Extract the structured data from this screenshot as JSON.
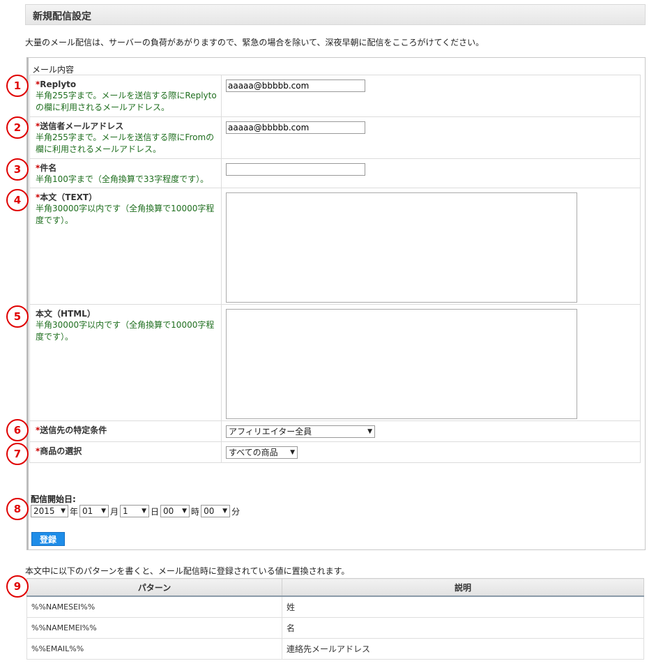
{
  "page_title": "新規配信設定",
  "notice": "大量のメール配信は、サーバーの負荷があがりますので、緊急の場合を除いて、深夜早朝に配信をこころがけてください。",
  "mail_section": {
    "legend": "メール内容",
    "required_mark": "*",
    "fields": [
      {
        "label": "Replyto",
        "hint": "半角255字まで。メールを送信する際にReplytoの欄に利用されるメールアドレス。",
        "value": "aaaaa@bbbbb.com"
      },
      {
        "label": "送信者メールアドレス",
        "hint": "半角255字まで。メールを送信する際にFromの欄に利用されるメールアドレス。",
        "value": "aaaaa@bbbbb.com"
      },
      {
        "label": "件名",
        "hint": "半角100字まで（全角換算で33字程度です）。",
        "value": ""
      },
      {
        "label": "本文（TEXT）",
        "hint": "半角30000字以内です（全角換算で10000字程度です）。",
        "value": ""
      },
      {
        "label": "本文（HTML）",
        "hint": "半角30000字以内です（全角換算で10000字程度です）。",
        "value": ""
      },
      {
        "label": "送信先の特定条件",
        "value": "アフィリエイター全員"
      },
      {
        "label": "商品の選択",
        "value": "すべての商品"
      }
    ]
  },
  "schedule": {
    "label": "配信開始日:",
    "year": "2015",
    "year_unit": "年",
    "month": "01",
    "month_unit": "月",
    "day": "1",
    "day_unit": "日",
    "hour": "00",
    "hour_unit": "時",
    "minute": "00",
    "minute_unit": "分"
  },
  "submit_label": "登録",
  "pattern_note": "本文中に以下のパターンを書くと、メール配信時に登録されている値に置換されます。",
  "pattern_table": {
    "headers": [
      "パターン",
      "説明"
    ],
    "rows": [
      {
        "pattern": "%%NAMESEI%%",
        "desc": "姓"
      },
      {
        "pattern": "%%NAMEMEI%%",
        "desc": "名"
      },
      {
        "pattern": "%%EMAIL%%",
        "desc": "連絡先メールアドレス"
      }
    ]
  },
  "badges": [
    "1",
    "2",
    "3",
    "4",
    "5",
    "6",
    "7",
    "8",
    "9"
  ],
  "colors": {
    "accent_button": "#1f8de8",
    "badge": "#e00000",
    "hint_text": "#1e6e1e",
    "required": "#cc0000"
  }
}
